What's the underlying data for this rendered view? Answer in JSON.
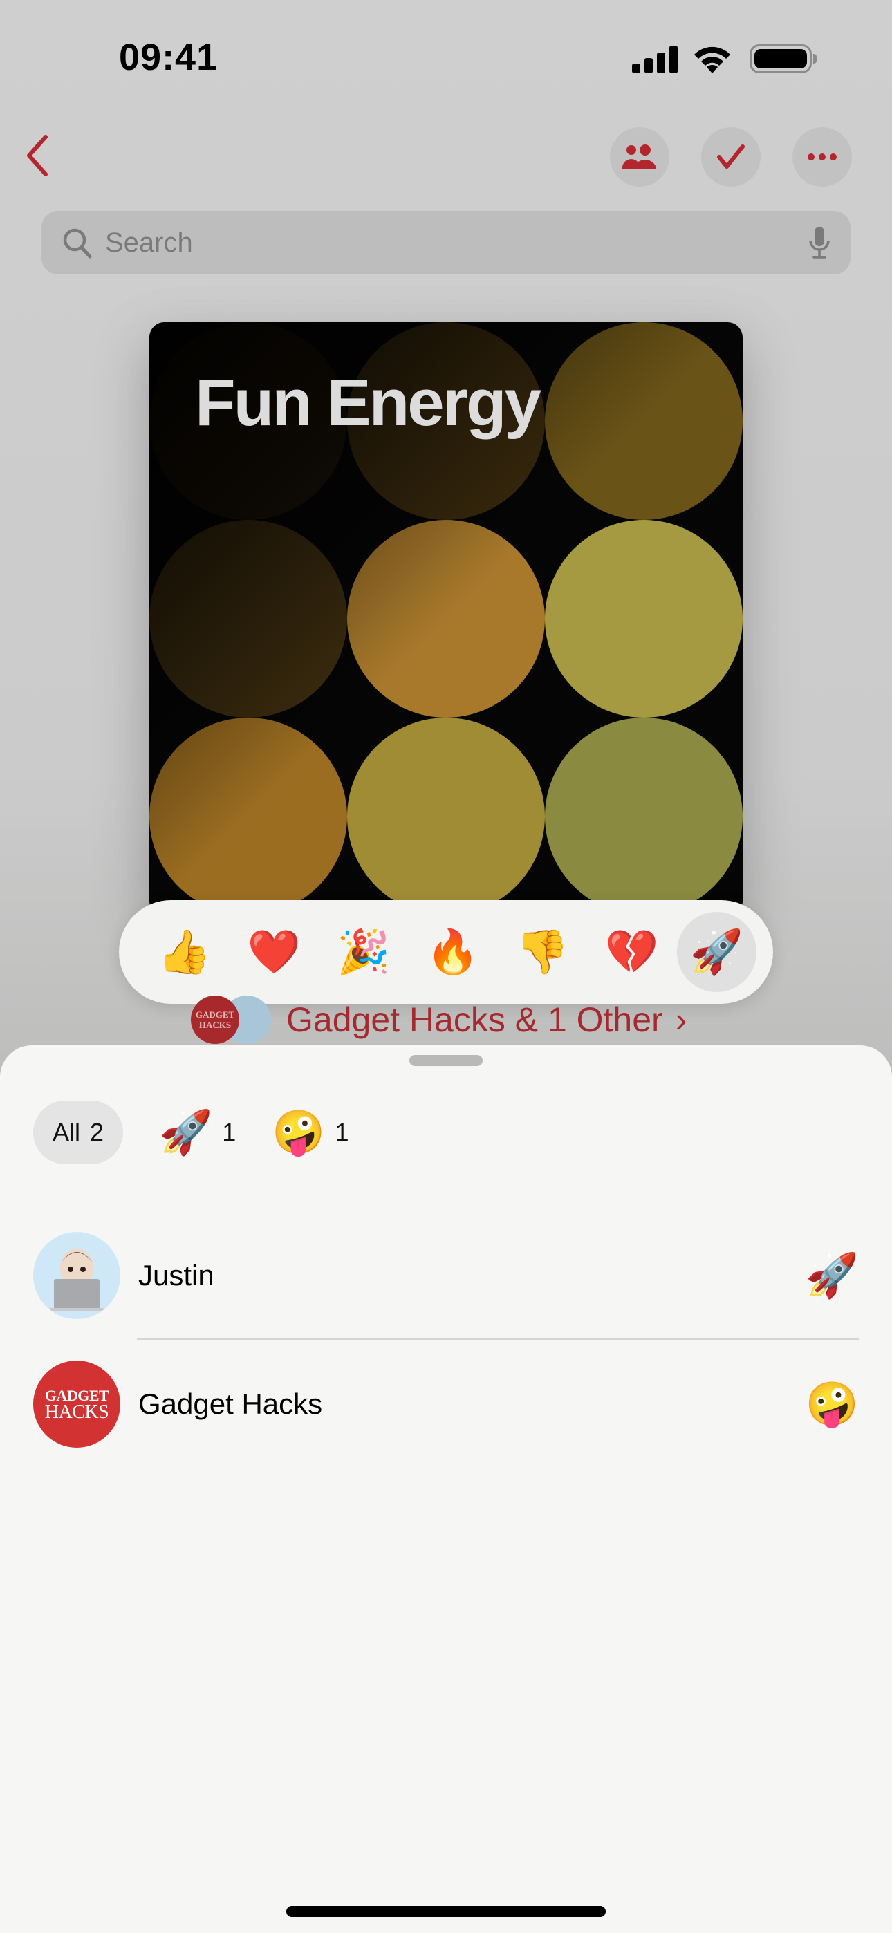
{
  "status_bar": {
    "time": "09:41",
    "signal_icon": "cellular-signal-icon",
    "wifi_icon": "wifi-icon",
    "battery_icon": "battery-icon",
    "battery_level": 1.0
  },
  "nav": {
    "back_icon": "chevron-left-icon",
    "buttons": [
      {
        "name": "participants",
        "icon": "people-icon"
      },
      {
        "name": "done",
        "icon": "checkmark-icon"
      },
      {
        "name": "more",
        "icon": "ellipsis-icon"
      }
    ],
    "accent_color": "#b4262d"
  },
  "search": {
    "placeholder": "Search",
    "value": "",
    "icon": "magnifying-glass-icon",
    "mic_icon": "microphone-icon"
  },
  "artwork": {
    "title": "Fun Energy",
    "dot_colors": [
      "#1b1307",
      "#3a2a0d",
      "#6a5317",
      "#3d2d0f",
      "#a8792b",
      "#a59a42",
      "#9b6d21",
      "#a08c35",
      "#8a8a40"
    ]
  },
  "tapback_bar": {
    "items": [
      {
        "name": "thumbs-up",
        "emoji": "👍",
        "selected": false
      },
      {
        "name": "heart",
        "emoji": "❤️",
        "selected": false
      },
      {
        "name": "party-popper",
        "emoji": "🎉",
        "selected": false
      },
      {
        "name": "fire",
        "emoji": "🔥",
        "selected": false
      },
      {
        "name": "thumbs-down",
        "emoji": "👎",
        "selected": false
      },
      {
        "name": "broken-heart",
        "emoji": "💔",
        "selected": false
      },
      {
        "name": "rocket",
        "emoji": "🚀",
        "selected": true
      }
    ]
  },
  "reacted_by": {
    "label": "Gadget Hacks & 1 Other",
    "chevron": "›",
    "mini_avatar_text": "GADGET HACKS"
  },
  "sheet": {
    "filters": [
      {
        "label": "All",
        "count": "2",
        "active": true
      },
      {
        "emoji": "🚀",
        "count": "1",
        "active": false
      },
      {
        "emoji": "🤪",
        "count": "1",
        "active": false
      }
    ],
    "reactions": [
      {
        "name": "Justin",
        "emoji": "🚀",
        "avatar_emoji": "🧑‍💻"
      },
      {
        "name": "Gadget Hacks",
        "emoji": "🤪",
        "avatar_line1": "GADGET",
        "avatar_line2": "HACKS"
      }
    ]
  }
}
